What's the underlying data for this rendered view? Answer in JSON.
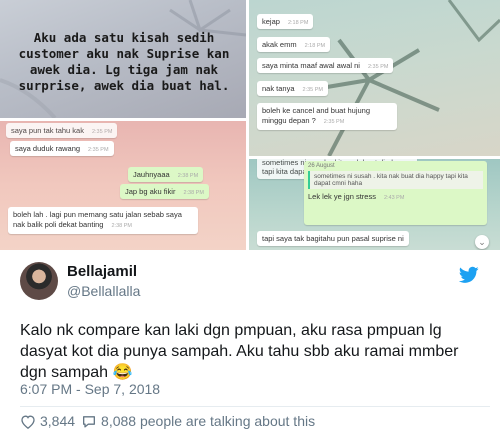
{
  "images": {
    "caption": "Aku ada satu kisah sedih customer aku nak Suprise kan awek dia. Lg tiga jam nak surprise, awek dia buat hal.",
    "chat_top_right": [
      {
        "text": "kejap",
        "time": "2:18 PM"
      },
      {
        "text": "akak emm",
        "time": "2:18 PM"
      },
      {
        "text": "saya minta maaf awal awal ni",
        "time": "2:35 PM"
      },
      {
        "text": "nak tanya",
        "time": "2:35 PM"
      },
      {
        "text": "boleh ke cancel and buat hujung minggu depan ?",
        "time": "2:35 PM"
      }
    ],
    "chat_bottom_left": [
      {
        "text": "saya pun tak tahu kak",
        "time": "2:35 PM"
      },
      {
        "text": "saya duduk rawang",
        "time": "2:35 PM"
      },
      {
        "text": "Jauhnyaaa",
        "time": "2:38 PM"
      },
      {
        "text": "Jap bg aku fikir",
        "time": "2:38 PM"
      },
      {
        "text": "boleh lah . lagi pun memang satu jalan sebab saya nak balik poli dekat banting",
        "time": "2:38 PM"
      }
    ],
    "chat_bottom_right": {
      "top_bubble": "sometimes ni susah . kita nak buat dia happy tapi kita dapat cmni haha",
      "date_label": "26 August",
      "quote": "sometimes ni susah . kita nak buat dia happy tapi kita dapat cmni haha",
      "reply": {
        "text": "Lek lek ye jgn stress",
        "time": "2:43 PM"
      },
      "last": "tapi saya tak bagitahu pun pasal suprise ni"
    }
  },
  "tweet": {
    "name": "Bellajamil",
    "handle": "@Bellallalla",
    "body": "Kalo nk compare kan laki dgn pmpuan, aku rasa pmpuan lg dasyat kot dia punya sampah. Aku tahu sbb aku ramai mmber dgn sampah",
    "emoji": "😂",
    "timestamp": "6:07 PM - Sep 7, 2018",
    "likes": "3,844",
    "talking": "8,088 people are talking about this"
  },
  "colors": {
    "twitter_blue": "#1da1f2",
    "wa_green": "#dcf8c6"
  }
}
